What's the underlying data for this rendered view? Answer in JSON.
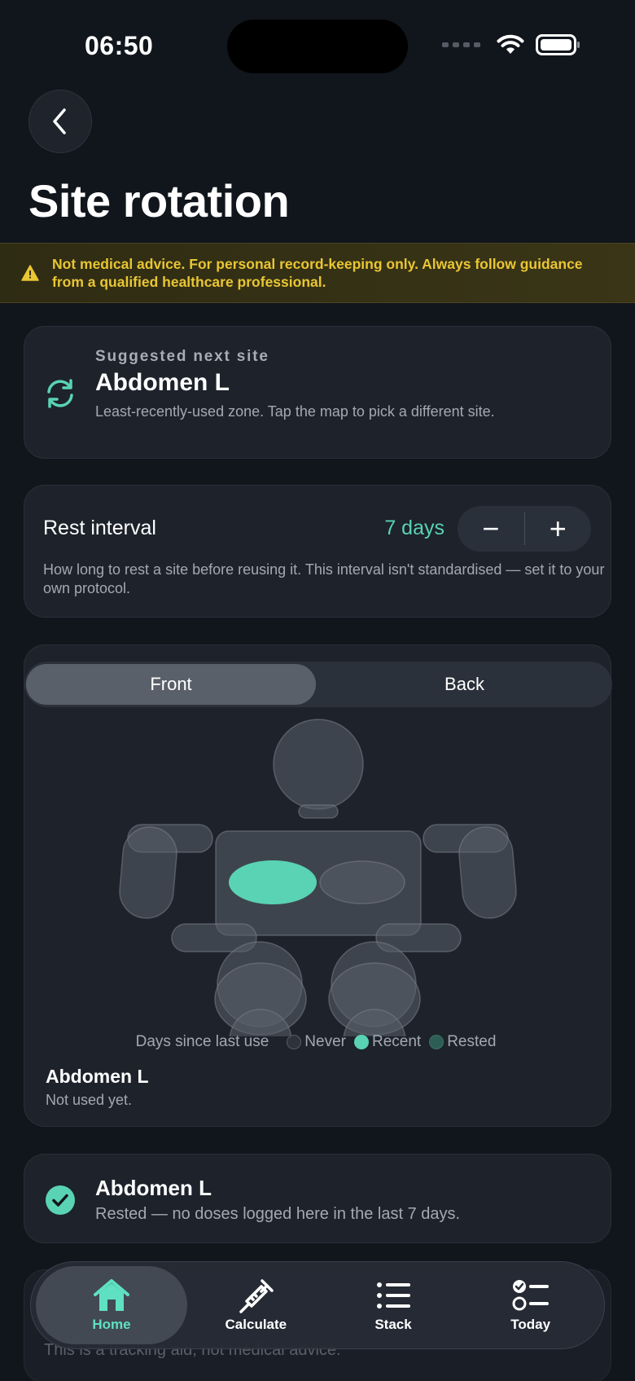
{
  "status_bar": {
    "time": "06:50"
  },
  "page": {
    "title": "Site rotation"
  },
  "banner": {
    "text": "Not medical advice. For personal record-keeping only. Always follow guidance from a qualified healthcare professional."
  },
  "suggestion": {
    "eyebrow": "Suggested next site",
    "site": "Abdomen L",
    "description": "Least-recently-used zone. Tap the map to pick a different site."
  },
  "rest_interval": {
    "label": "Rest interval",
    "value": "7 days",
    "decrement": "−",
    "increment": "+",
    "description": "How long to rest a site before reusing it. This interval isn't standardised — set it to your own protocol."
  },
  "body_map": {
    "tabs": {
      "front": "Front",
      "back": "Back"
    },
    "selected_tab": "Front",
    "legend": {
      "title": "Days since last use",
      "items": [
        {
          "label": "Never",
          "color": "#3a3f47"
        },
        {
          "label": "Recent",
          "color": "#59d3b4"
        },
        {
          "label": "Rested",
          "color": "#2d5e55"
        }
      ]
    },
    "selected_site": "Abdomen L",
    "selected_status": "Not used yet."
  },
  "site_status": {
    "site": "Abdomen L",
    "description": "Rested — no doses logged here in the last 7 days."
  },
  "footer_note": "This is a tracking aid, not medical advice.",
  "tabbar": {
    "items": [
      {
        "label": "Home",
        "icon": "home-icon",
        "active": true
      },
      {
        "label": "Calculate",
        "icon": "syringe-icon",
        "active": false
      },
      {
        "label": "Stack",
        "icon": "list-icon",
        "active": false
      },
      {
        "label": "Today",
        "icon": "checklist-icon",
        "active": false
      }
    ]
  },
  "colors": {
    "accent": "#59d3b4",
    "warning": "#e9c633",
    "background": "#11151c"
  }
}
